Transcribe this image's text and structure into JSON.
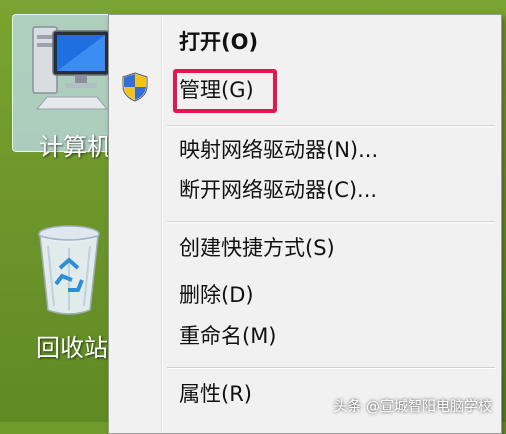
{
  "desktop": {
    "icons": [
      {
        "label": "计算机"
      },
      {
        "label": "回收站"
      }
    ]
  },
  "context_menu": {
    "items": [
      {
        "label": "打开(O)",
        "bold": true
      },
      {
        "label": "管理(G)",
        "highlighted": true,
        "icon": "uac-shield-icon"
      },
      {
        "label": "映射网络驱动器(N)..."
      },
      {
        "label": "断开网络驱动器(C)..."
      },
      {
        "label": "创建快捷方式(S)"
      },
      {
        "label": "删除(D)"
      },
      {
        "label": "重命名(M)"
      },
      {
        "label": "属性(R)"
      }
    ],
    "highlight_color": "#e2174f"
  },
  "watermark": {
    "text": "头条 @宣城智阳电脑学校"
  }
}
